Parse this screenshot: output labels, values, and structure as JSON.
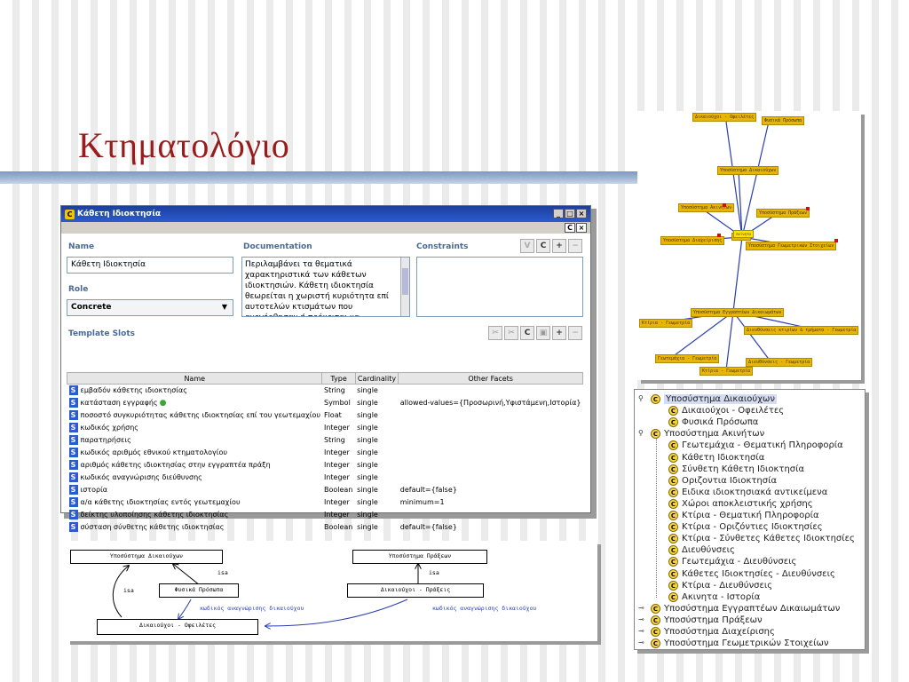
{
  "slide": {
    "title": "Κτηματολόγιο"
  },
  "window": {
    "title": "Κάθετη Ιδιοκτησία",
    "controls": [
      "_",
      "□",
      "×"
    ],
    "sub_controls": [
      "C",
      "×"
    ],
    "name_label": "Name",
    "name_value": "Κάθετη Ιδιοκτησία",
    "documentation_label": "Documentation",
    "documentation_text": "Περιλαμβάνει τα θεματικά χαρακτηριστικά των κάθετων ιδιοκτησιών. Κάθετη ιδιοκτησία θεωρείται η χωριστή κυριότητα επί αυτοτελών κτισμάτων που ανεγέρθησαν ή πρόκειται να ανεγερθούν σε ενιαίο",
    "constraints_label": "Constraints",
    "constraint_buttons": [
      "V",
      "C",
      "+",
      "−"
    ],
    "role_label": "Role",
    "role_value": "Concrete",
    "template_slots_label": "Template Slots",
    "slot_buttons": [
      "✂",
      "✂",
      "C",
      "▣",
      "+",
      "−"
    ],
    "columns": [
      "Name",
      "Type",
      "Cardinality",
      "Other Facets"
    ],
    "rows": [
      {
        "name": "εμβαδόν κάθετης ιδιοκτησίας",
        "type": "String",
        "card": "single",
        "facets": ""
      },
      {
        "name": "κατάσταση εγγραφής",
        "type": "Symbol",
        "card": "single",
        "facets": "allowed-values={Προσωρινή,Υφιστάμενη,Ιστορία}"
      },
      {
        "name": "ποσοστό συγκυριότητας κάθετης ιδιοκτησίας επί του γεωτεμαχίου",
        "type": "Float",
        "card": "single",
        "facets": ""
      },
      {
        "name": "κωδικός χρήσης",
        "type": "Integer",
        "card": "single",
        "facets": ""
      },
      {
        "name": "παρατηρήσεις",
        "type": "String",
        "card": "single",
        "facets": ""
      },
      {
        "name": "κωδικός αριθμός εθνικού κτηματολογίου",
        "type": "Integer",
        "card": "single",
        "facets": ""
      },
      {
        "name": "αριθμός κάθετης ιδιοκτησίας στην εγγραπτέα πράξη",
        "type": "Integer",
        "card": "single",
        "facets": ""
      },
      {
        "name": "κωδικός αναγνώρισης διεύθυνσης",
        "type": "Integer",
        "card": "single",
        "facets": ""
      },
      {
        "name": "ιστορία",
        "type": "Boolean",
        "card": "single",
        "facets": "default={false}"
      },
      {
        "name": "α/α κάθετης ιδιοκτησίας εντός γεωτεμαχίου",
        "type": "Integer",
        "card": "single",
        "facets": "minimum=1"
      },
      {
        "name": "δείκτης υλοποίησης κάθετης ιδιοκτησίας",
        "type": "Integer",
        "card": "single",
        "facets": ""
      },
      {
        "name": "σύσταση σύνθετης κάθετης ιδιοκτησίας",
        "type": "Boolean",
        "card": "single",
        "facets": "default={false}"
      }
    ]
  },
  "graph": {
    "nodes": [
      "Δικαιούχοι - Οφειλέτες",
      "Φυσικά Πρόσωπα",
      "Υποσύστημα Δικαιούχων",
      "Υποσύστημα Ακινήτων",
      "Υποσύστημα Πράξεων",
      "Υποσύστημα Διαχείρισης",
      "Υποσύστημα Γεωμετρικών Στοιχείων",
      "Υποσύστημα Εγγραπτέων Δικαιωμάτων",
      "Κτίρια - Γεωμετρία",
      "Διευθύνσεις κτιρίων & τμήματα - Γεωμετρία",
      "Γεωτεμάχια - Γεωμετρία",
      "Διευθύνσεις - Γεωμετρία",
      "Κτίρια - Γεωμετρία",
      "Ακίνητα"
    ]
  },
  "tree": {
    "items": [
      {
        "label": "Υποσύστημα Δικαιούχων",
        "level": 0,
        "handle": "open",
        "selected": true
      },
      {
        "label": "Δικαιούχοι - Οφειλέτες",
        "level": 1
      },
      {
        "label": "Φυσικά Πρόσωπα",
        "level": 1
      },
      {
        "label": "Υποσύστημα Ακινήτων",
        "level": 0,
        "handle": "open"
      },
      {
        "label": "Γεωτεμάχια - Θεματική Πληροφορία",
        "level": 1
      },
      {
        "label": "Κάθετη Ιδιοκτησία",
        "level": 1
      },
      {
        "label": "Σύνθετη Κάθετη Ιδιοκτησία",
        "level": 1
      },
      {
        "label": "Οριζοντια Ιδιοκτησία",
        "level": 1
      },
      {
        "label": "Ειδικα ιδιοκτησιακά αντικείμενα",
        "level": 1
      },
      {
        "label": "Χώροι αποκλειστικής χρήσης",
        "level": 1
      },
      {
        "label": "Κτίρια - Θεματική Πληροφορία",
        "level": 1
      },
      {
        "label": "Κτίρια - Οριζόντιες Ιδιοκτησίες",
        "level": 1
      },
      {
        "label": "Κτίρια - Σύνθετες Κάθετες Ιδιοκτησίες",
        "level": 1
      },
      {
        "label": "Διευθύνσεις",
        "level": 1
      },
      {
        "label": "Γεωτεμάχια - Διευθύνσεις",
        "level": 1
      },
      {
        "label": "Κάθετες Ιδιοκτησίες - Διευθύνσεις",
        "level": 1
      },
      {
        "label": "Κτίρια - Διευθύνσεις",
        "level": 1
      },
      {
        "label": "Ακινητα - Ιστορία",
        "level": 1
      },
      {
        "label": "Υποσύστημα Εγγραπτέων Δικαιωμάτων",
        "level": 0,
        "handle": "closed"
      },
      {
        "label": "Υποσύστημα Πράξεων",
        "level": 0,
        "handle": "closed"
      },
      {
        "label": "Υποσύστημα Διαχείρισης",
        "level": 0,
        "handle": "closed"
      },
      {
        "label": "Υποσύστημα Γεωμετρικών Στοιχείων",
        "level": 0,
        "handle": "closed"
      }
    ]
  },
  "uml": {
    "nodes": {
      "beneficiaries": "Υποσύστημα Δικαιούχων",
      "acts": "Υποσύστημα Πράξεων",
      "natural_persons": "Φυσικά Πρόσωπα",
      "beneficiaries_acts": "Δικαιούχοι - Πράξεις",
      "beneficiaries_debtors": "Δικαιούχοι - Οφειλέτες"
    },
    "labels": {
      "isa_1": "isa",
      "isa_2": "isa",
      "isa_3": "isa",
      "code_1": "κωδικός αναγνώρισης δικαιούχου",
      "code_2": "κωδικός αναγνώρισης δικαιούχου"
    }
  }
}
